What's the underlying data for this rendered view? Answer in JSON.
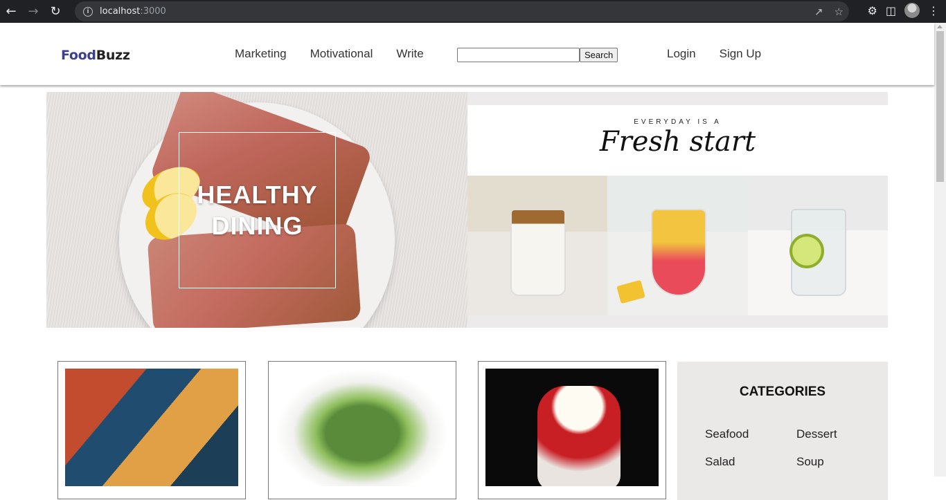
{
  "browser": {
    "url_host": "localhost",
    "url_port": ":3000"
  },
  "header": {
    "logo_part1": "Food",
    "logo_part2": "Buzz",
    "menu": [
      "Marketing",
      "Motivational",
      "Write"
    ],
    "search_button": "Search",
    "search_value": "",
    "login": "Login",
    "signup": "Sign Up"
  },
  "hero": {
    "title_line1": "HEALTHY",
    "title_line2": "DINING",
    "tagline_top": "EVERYDAY IS A",
    "tagline_script": "Fresh start"
  },
  "categories": {
    "title": "CATEGORIES",
    "items": [
      "Seafood",
      "Dessert",
      "Salad",
      "Soup"
    ]
  },
  "colors": {
    "logo_food": "#3a3f8f",
    "logo_buzz": "#222222",
    "categories_bg": "#ebe8e8"
  }
}
